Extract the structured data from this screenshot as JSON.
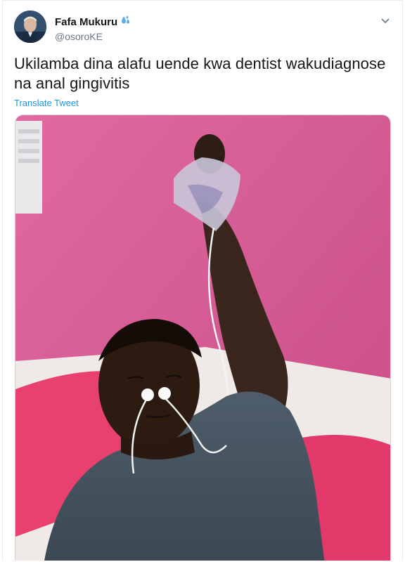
{
  "tweet": {
    "author": {
      "display_name": "Fafa Mukuru",
      "handle": "@osoroKE",
      "avatar_icon": "avatar-photo",
      "badge_icon": "droplets-emoji-icon"
    },
    "menu_icon": "chevron-down-icon",
    "text_line1": "Ukilamba dina alafu uende kwa dentist wakudiagnose",
    "text_line2": "na anal gingivitis",
    "translate_label": "Translate Tweet",
    "media": {
      "description_icon": "photo-man-lying-with-earphones-in-nose"
    },
    "colors": {
      "text": "#14171a",
      "secondary": "#657786",
      "link": "#1b95e0",
      "wall": "#d8548f"
    }
  }
}
